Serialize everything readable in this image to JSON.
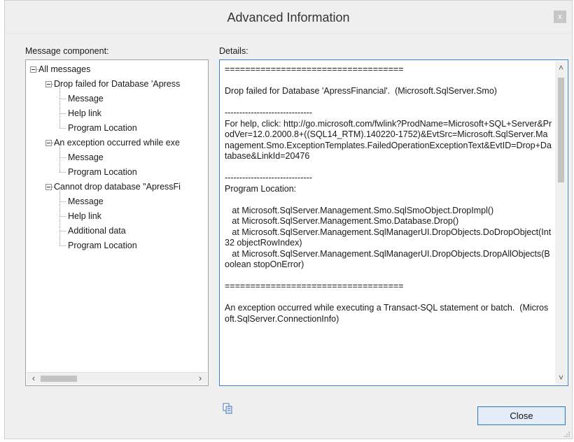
{
  "window": {
    "title": "Advanced Information",
    "close_glyph": "x"
  },
  "left_panel": {
    "label": "Message component:"
  },
  "tree": [
    {
      "label": "All messages",
      "level": 0,
      "expander": true
    },
    {
      "label": "Drop failed for Database 'Apress",
      "level": 1,
      "expander": true
    },
    {
      "label": "Message",
      "level": 2,
      "expander": false
    },
    {
      "label": "Help link",
      "level": 2,
      "expander": false
    },
    {
      "label": "Program Location",
      "level": 2,
      "expander": false
    },
    {
      "label": "An exception occurred while exe",
      "level": 1,
      "expander": true
    },
    {
      "label": "Message",
      "level": 2,
      "expander": false
    },
    {
      "label": "Program Location",
      "level": 2,
      "expander": false
    },
    {
      "label": "Cannot drop database \"ApressFi",
      "level": 1,
      "expander": true
    },
    {
      "label": "Message",
      "level": 2,
      "expander": false
    },
    {
      "label": "Help link",
      "level": 2,
      "expander": false
    },
    {
      "label": "Additional data",
      "level": 2,
      "expander": false
    },
    {
      "label": "Program Location",
      "level": 2,
      "expander": false
    }
  ],
  "details": {
    "label": "Details:",
    "text": "===================================\n\nDrop failed for Database 'ApressFinancial'.  (Microsoft.SqlServer.Smo)\n\n------------------------------\nFor help, click: http://go.microsoft.com/fwlink?ProdName=Microsoft+SQL+Server&ProdVer=12.0.2000.8+((SQL14_RTM).140220-1752)&EvtSrc=Microsoft.SqlServer.Management.Smo.ExceptionTemplates.FailedOperationExceptionText&EvtID=Drop+Database&LinkId=20476\n\n------------------------------\nProgram Location:\n\n   at Microsoft.SqlServer.Management.Smo.SqlSmoObject.DropImpl()\n   at Microsoft.SqlServer.Management.Smo.Database.Drop()\n   at Microsoft.SqlServer.Management.SqlManagerUI.DropObjects.DoDropObject(Int32 objectRowIndex)\n   at Microsoft.SqlServer.Management.SqlManagerUI.DropObjects.DropAllObjects(Boolean stopOnError)\n\n===================================\n\nAn exception occurred while executing a Transact-SQL statement or batch.  (Microsoft.SqlServer.ConnectionInfo)"
  },
  "buttons": {
    "close_label": "Close",
    "copy_icon": "copy-icon"
  },
  "colors": {
    "focus_border": "#3d7fd1",
    "button_border": "#3c7fb1"
  }
}
